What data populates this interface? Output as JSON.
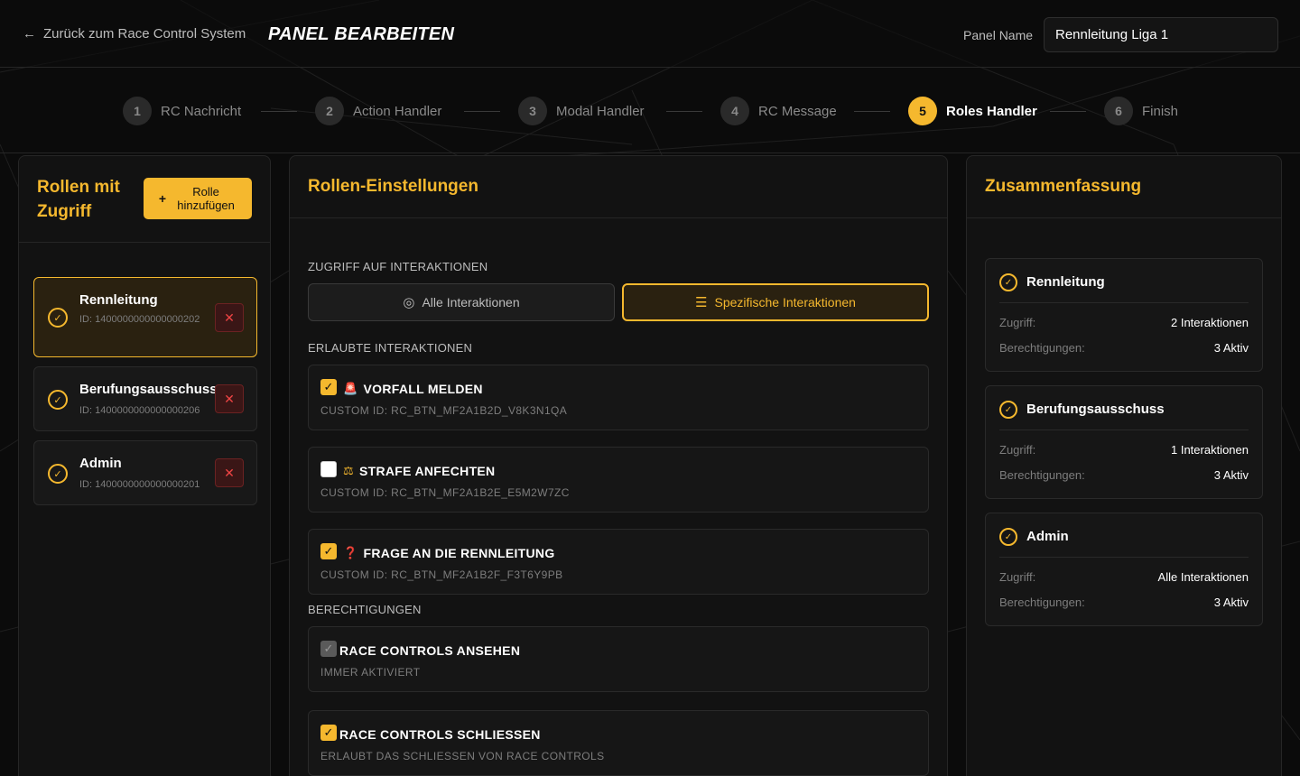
{
  "header": {
    "back_label": "Zurück zum Race Control System",
    "title": "PANEL BEARBEITEN",
    "panel_name_label": "Panel Name",
    "panel_name_value": "Rennleitung Liga 1"
  },
  "steps": [
    {
      "num": "1",
      "label": "RC Nachricht"
    },
    {
      "num": "2",
      "label": "Action Handler"
    },
    {
      "num": "3",
      "label": "Modal Handler"
    },
    {
      "num": "4",
      "label": "RC Message"
    },
    {
      "num": "5",
      "label": "Roles Handler",
      "active": true
    },
    {
      "num": "6",
      "label": "Finish"
    }
  ],
  "left": {
    "title": "Rollen mit Zugriff",
    "add_button": "Rolle hinzufügen",
    "roles": [
      {
        "name": "Rennleitung",
        "id": "ID: 1400000000000000202",
        "selected": true
      },
      {
        "name": "Berufungsausschuss",
        "id": "ID: 1400000000000000206"
      },
      {
        "name": "Admin",
        "id": "ID: 1400000000000000201"
      }
    ]
  },
  "middle": {
    "title": "Rollen-Einstellungen",
    "access_label": "ZUGRIFF AUF INTERAKTIONEN",
    "toggle_all": "Alle Interaktionen",
    "toggle_specific": "Spezifische Interaktionen",
    "allowed_label": "ERLAUBTE INTERAKTIONEN",
    "interactions": [
      {
        "emoji": "🚨",
        "title": "VORFALL MELDEN",
        "sub": "CUSTOM ID: RC_BTN_MF2A1B2D_V8K3N1QA",
        "checked": true
      },
      {
        "emoji": "⚖",
        "title": "STRAFE ANFECHTEN",
        "sub": "CUSTOM ID: RC_BTN_MF2A1B2E_E5M2W7ZC",
        "checked": false
      },
      {
        "emoji": "❓",
        "title": "FRAGE AN DIE RENNLEITUNG",
        "sub": "CUSTOM ID: RC_BTN_MF2A1B2F_F3T6Y9PB",
        "checked": true
      }
    ],
    "permissions_label": "BERECHTIGUNGEN",
    "permissions": [
      {
        "title": "RACE CONTROLS ANSEHEN",
        "sub": "IMMER AKTIVIERT",
        "state": "disabled"
      },
      {
        "title": "RACE CONTROLS SCHLIESSEN",
        "sub": "ERLAUBT DAS SCHLIESSEN VON RACE CONTROLS",
        "state": "on"
      }
    ]
  },
  "right": {
    "title": "Zusammenfassung",
    "access_key": "Zugriff:",
    "perm_key": "Berechtigungen:",
    "summaries": [
      {
        "name": "Rennleitung",
        "access": "2 Interaktionen",
        "perms": "3 Aktiv"
      },
      {
        "name": "Berufungsausschuss",
        "access": "1 Interaktionen",
        "perms": "3 Aktiv"
      },
      {
        "name": "Admin",
        "access": "Alle Interaktionen",
        "perms": "3 Aktiv"
      }
    ]
  },
  "colors": {
    "accent": "#f5b82e",
    "danger": "#ef4444",
    "background": "#0b0b0b"
  }
}
